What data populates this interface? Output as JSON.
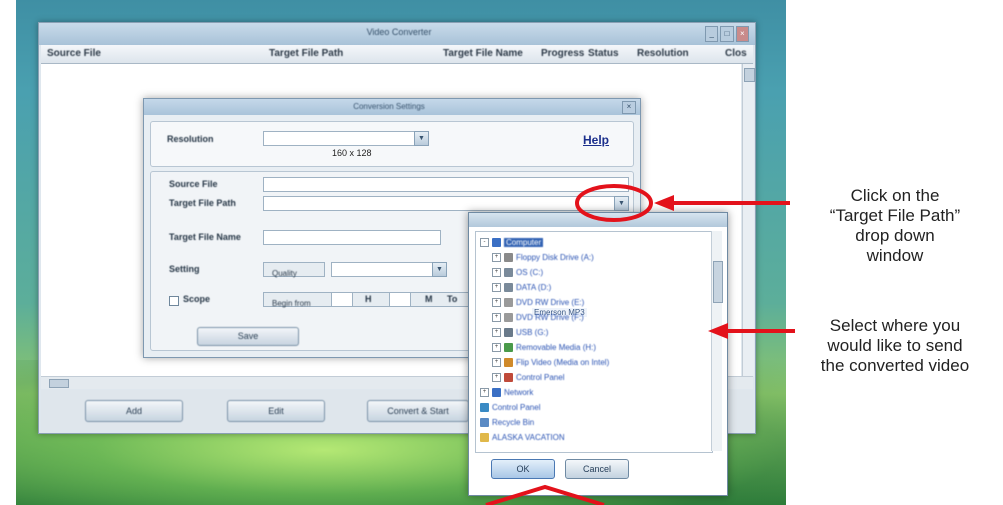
{
  "main_window": {
    "title": "Video Converter",
    "columns": [
      "Source File",
      "Target File Path",
      "Target File Name",
      "Progress",
      "Status",
      "Resolution",
      "Clos"
    ],
    "buttons": {
      "add": "Add",
      "edit": "Edit",
      "convert": "Convert & Start"
    },
    "window_controls": {
      "minimize": "_",
      "maximize": "□",
      "close": "×"
    }
  },
  "dialog": {
    "title": "Conversion Settings",
    "resolution_label": "Resolution",
    "resolution_value": "160 x 128",
    "help_label": "Help",
    "source_file_label": "Source File",
    "target_path_label": "Target File Path",
    "target_name_label": "Target File Name",
    "setting_label": "Setting",
    "quality_label": "Quality",
    "scope_label": "Scope",
    "begin_from_label": "Begin from",
    "h_label": "H",
    "m_label": "M",
    "to_label": "To",
    "save_label": "Save"
  },
  "folder_browser": {
    "items": [
      {
        "label": "Computer",
        "icon_color": "#3a6fc4",
        "expand": "-",
        "indent": 0,
        "selected": true
      },
      {
        "label": "Floppy Disk Drive (A:)",
        "icon_color": "#8a8a8a",
        "expand": "+",
        "indent": 1
      },
      {
        "label": "OS (C:)",
        "icon_color": "#7a8a9a",
        "expand": "+",
        "indent": 1
      },
      {
        "label": "DATA (D:)",
        "icon_color": "#7a8a9a",
        "expand": "+",
        "indent": 1
      },
      {
        "label": "DVD RW Drive (E:)",
        "icon_color": "#9a9a9a",
        "expand": "+",
        "indent": 1
      },
      {
        "label": "DVD RW Drive (F:)",
        "icon_color": "#9a9a9a",
        "expand": "+",
        "indent": 1
      },
      {
        "label": "USB (G:)",
        "icon_color": "#6a7a8a",
        "expand": "+",
        "indent": 1
      },
      {
        "label": "Removable Media (H:)",
        "icon_color": "#4a9a4a",
        "expand": "+",
        "indent": 1
      },
      {
        "label": "Flip Video (Media on Intel)",
        "icon_color": "#d08a2a",
        "expand": "+",
        "indent": 1
      },
      {
        "label": "Control Panel",
        "icon_color": "#c04a3a",
        "expand": "+",
        "indent": 1
      },
      {
        "label": "Network",
        "icon_color": "#3a6fc4",
        "expand": "+",
        "indent": 0
      },
      {
        "label": "Control Panel",
        "icon_color": "#3a8ac4",
        "expand": "",
        "indent": 0
      },
      {
        "label": "Recycle Bin",
        "icon_color": "#5a8ac4",
        "expand": "",
        "indent": 0
      },
      {
        "label": "ALASKA VACATION",
        "icon_color": "#e0b84a",
        "expand": "",
        "indent": 0
      }
    ],
    "tooltip": "Emerson MP3",
    "ok_label": "OK",
    "cancel_label": "Cancel"
  },
  "annotations": {
    "click_text": "Click on the \n“Target File Path” \ndrop down \nwindow",
    "select_text": "Select where you \nwould like to send \nthe converted video",
    "accent_color": "#e3121b"
  }
}
